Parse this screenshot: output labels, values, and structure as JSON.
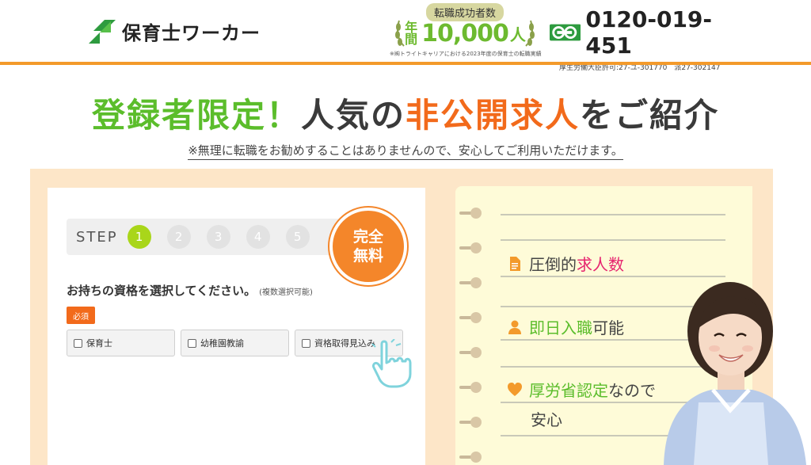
{
  "header": {
    "logo_text": "保育士ワーカー",
    "badge_top": "転職成功者数",
    "badge_prefix_1": "年",
    "badge_prefix_2": "間",
    "badge_count": "10,000",
    "badge_unit": "人",
    "badge_note": "※㈱トライトキャリアにおける2023年度の保育士の転職実績",
    "phone_number": "0120-019-451",
    "license": "厚生労働大臣許可:27-ユ-301770　派27-302147"
  },
  "hero": {
    "title_part1": "登録者限定！",
    "title_part2": "人気の",
    "title_part3": "非公開求人",
    "title_part4": "をご紹介",
    "subtitle": "※無理に転職をお勧めすることはありませんので、安心してご利用いただけます。"
  },
  "form": {
    "step_label": "STEP",
    "steps": [
      "1",
      "2",
      "3",
      "4",
      "5"
    ],
    "free_badge_line1": "完全",
    "free_badge_line2": "無料",
    "question": "お持ちの資格を選択してください。",
    "question_note": "(複数選択可能)",
    "required_label": "必須",
    "options": [
      "保育士",
      "幼稚園教諭",
      "資格取得見込み"
    ]
  },
  "features": [
    {
      "prefix": "圧倒的",
      "highlight": "求人数",
      "suffix": "",
      "icon": "document-icon"
    },
    {
      "prefix": "",
      "highlight": "即日入職",
      "suffix": "可能",
      "icon": "person-icon"
    },
    {
      "prefix": "",
      "highlight": "厚労省認定",
      "suffix": "なので",
      "icon": "heart-icon"
    }
  ],
  "feature_line4": "安心",
  "colors": {
    "accent_orange": "#f39a2b",
    "brand_green": "#5bbd2b",
    "highlight_orange": "#f26a1b",
    "pink": "#e6246f",
    "panel_bg": "#fde6c8"
  }
}
